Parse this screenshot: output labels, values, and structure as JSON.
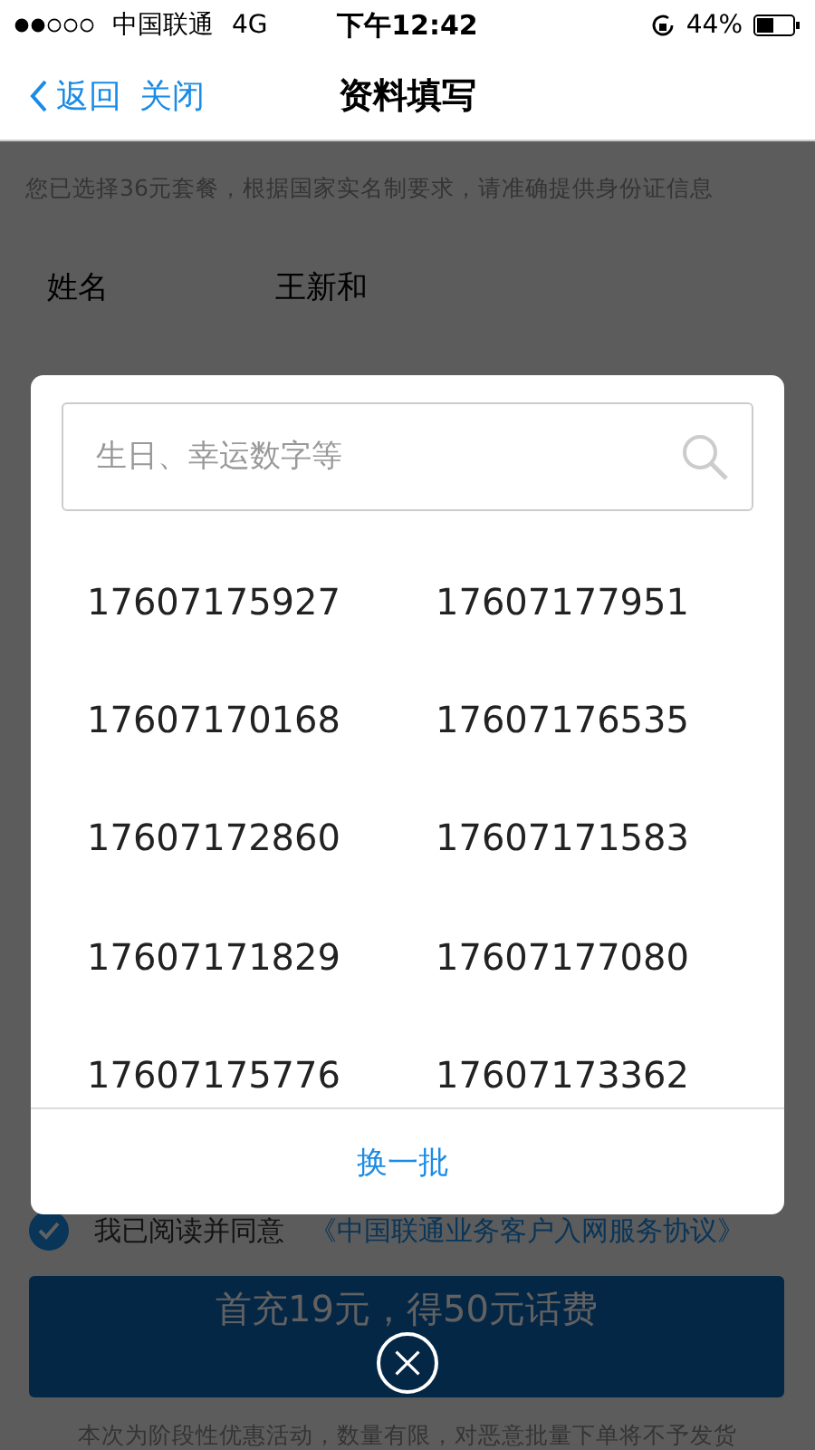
{
  "status_bar": {
    "carrier": "中国联通",
    "network": "4G",
    "time": "下午12:42",
    "battery": "44%"
  },
  "nav": {
    "back": "返回",
    "close": "关闭",
    "title": "资料填写"
  },
  "notice": "您已选择36元套餐，根据国家实名制要求，请准确提供身份证信息",
  "form": [
    {
      "label": "姓名",
      "value": "王新和"
    }
  ],
  "agreement": {
    "checked": true,
    "text": "我已阅读并同意",
    "link": "《中国联通业务客户入网服务协议》"
  },
  "submit": "首充19元，得50元话费",
  "footnote": "本次为阶段性优惠活动，数量有限，对恶意批量下单将不予发货",
  "modal": {
    "search": {
      "placeholder": "生日、幸运数字等"
    },
    "numbers": [
      "17607175927",
      "17607177951",
      "17607170168",
      "17607176535",
      "17607172860",
      "17607171583",
      "17607171829",
      "17607177080",
      "17607175776",
      "17607173362"
    ],
    "refresh": "换一批"
  }
}
